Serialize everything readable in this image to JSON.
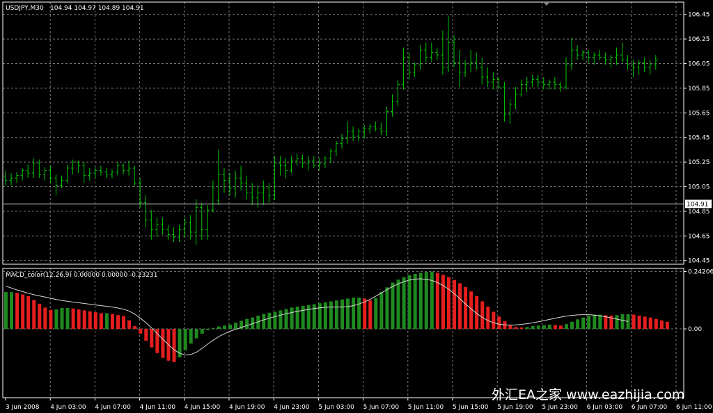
{
  "colors": {
    "background": "#000000",
    "frame": "#ffffff",
    "grid": "#7a7a7a",
    "bars": "#00c800",
    "macd_up": "#1f8a1f",
    "macd_down": "#e61e1e",
    "signal": "#d8d8d8",
    "current_price_bg": "#ffffff",
    "current_price_text": "#000000"
  },
  "header": {
    "symbol_label": "USDJPY,M30",
    "ohlc_label": "104.94 104.97 104.89 104.91"
  },
  "indicator": {
    "label": "MACD_color(12,26,9) 0.00000 0.00000 -0.23231"
  },
  "watermark": "外汇EA之家 www.eazhijia.com",
  "chart_data": [
    {
      "type": "ohlc",
      "title": "USDJPY,M30",
      "current_price": "104.91",
      "ylim": [
        104.42,
        106.55
      ],
      "y_ticks": [
        "106.45",
        "106.25",
        "106.05",
        "105.85",
        "105.65",
        "105.45",
        "105.25",
        "105.05",
        "104.85",
        "104.65",
        "104.45"
      ],
      "x_ticks": [
        "3 Jun 2008",
        "4 Jun 03:00",
        "4 Jun 07:00",
        "4 Jun 11:00",
        "4 Jun 15:00",
        "4 Jun 19:00",
        "4 Jun 23:00",
        "5 Jun 03:00",
        "5 Jun 07:00",
        "5 Jun 11:00",
        "5 Jun 15:00",
        "5 Jun 19:00",
        "5 Jun 23:00",
        "6 Jun 03:00",
        "6 Jun 07:00",
        "6 Jun 11:00"
      ],
      "grid": true,
      "bars": [
        [
          105.13,
          105.18,
          105.06,
          105.1
        ],
        [
          105.1,
          105.16,
          105.06,
          105.12
        ],
        [
          105.12,
          105.17,
          105.08,
          105.14
        ],
        [
          105.14,
          105.2,
          105.1,
          105.18
        ],
        [
          105.18,
          105.23,
          105.12,
          105.16
        ],
        [
          105.16,
          105.28,
          105.12,
          105.24
        ],
        [
          105.24,
          105.27,
          105.12,
          105.15
        ],
        [
          105.15,
          105.21,
          105.1,
          105.18
        ],
        [
          105.18,
          105.22,
          105.08,
          105.12
        ],
        [
          105.12,
          105.15,
          104.98,
          105.06
        ],
        [
          105.06,
          105.14,
          105.04,
          105.1
        ],
        [
          105.1,
          105.23,
          105.08,
          105.2
        ],
        [
          105.2,
          105.27,
          105.15,
          105.25
        ],
        [
          105.25,
          105.26,
          105.16,
          105.22
        ],
        [
          105.22,
          105.25,
          105.08,
          105.14
        ],
        [
          105.14,
          105.2,
          105.1,
          105.16
        ],
        [
          105.16,
          105.21,
          105.12,
          105.18
        ],
        [
          105.18,
          105.22,
          105.14,
          105.17
        ],
        [
          105.17,
          105.2,
          105.12,
          105.15
        ],
        [
          105.15,
          105.19,
          105.12,
          105.17
        ],
        [
          105.17,
          105.25,
          105.14,
          105.22
        ],
        [
          105.22,
          105.24,
          105.15,
          105.18
        ],
        [
          105.18,
          105.26,
          105.14,
          105.2
        ],
        [
          105.2,
          105.22,
          105.05,
          105.08
        ],
        [
          105.08,
          105.12,
          104.88,
          104.92
        ],
        [
          104.92,
          104.98,
          104.72,
          104.78
        ],
        [
          104.78,
          104.86,
          104.62,
          104.7
        ],
        [
          104.7,
          104.8,
          104.64,
          104.74
        ],
        [
          104.74,
          104.8,
          104.66,
          104.7
        ],
        [
          104.7,
          104.74,
          104.62,
          104.66
        ],
        [
          104.66,
          104.72,
          104.6,
          104.64
        ],
        [
          104.64,
          104.74,
          104.6,
          104.7
        ],
        [
          104.7,
          104.8,
          104.64,
          104.76
        ],
        [
          104.76,
          104.82,
          104.62,
          104.68
        ],
        [
          104.68,
          104.95,
          104.58,
          104.88
        ],
        [
          104.88,
          104.92,
          104.62,
          104.7
        ],
        [
          104.7,
          104.9,
          104.62,
          104.86
        ],
        [
          104.86,
          105.1,
          104.84,
          105.04
        ],
        [
          104.94,
          105.35,
          104.9,
          105.15
        ],
        [
          105.15,
          105.2,
          105.0,
          105.1
        ],
        [
          105.1,
          105.16,
          104.98,
          105.04
        ],
        [
          105.04,
          105.18,
          104.96,
          105.12
        ],
        [
          105.12,
          105.22,
          105.02,
          105.08
        ],
        [
          105.08,
          105.14,
          104.94,
          105.0
        ],
        [
          105.0,
          105.08,
          104.9,
          104.96
        ],
        [
          104.96,
          105.06,
          104.88,
          105.0
        ],
        [
          105.0,
          105.1,
          104.9,
          105.04
        ],
        [
          105.04,
          105.08,
          104.92,
          104.98
        ],
        [
          104.98,
          105.3,
          104.94,
          105.24
        ],
        [
          105.24,
          105.3,
          105.14,
          105.22
        ],
        [
          105.22,
          105.28,
          105.12,
          105.18
        ],
        [
          105.18,
          105.3,
          105.16,
          105.26
        ],
        [
          105.26,
          105.32,
          105.22,
          105.28
        ],
        [
          105.28,
          105.31,
          105.2,
          105.24
        ],
        [
          105.24,
          105.3,
          105.18,
          105.26
        ],
        [
          105.26,
          105.3,
          105.2,
          105.22
        ],
        [
          105.22,
          105.28,
          105.18,
          105.24
        ],
        [
          105.24,
          105.3,
          105.2,
          105.28
        ],
        [
          105.28,
          105.36,
          105.24,
          105.34
        ],
        [
          105.34,
          105.42,
          105.3,
          105.4
        ],
        [
          105.4,
          105.48,
          105.36,
          105.44
        ],
        [
          105.44,
          105.58,
          105.4,
          105.5
        ],
        [
          105.5,
          105.54,
          105.42,
          105.46
        ],
        [
          105.46,
          105.52,
          105.42,
          105.5
        ],
        [
          105.5,
          105.55,
          105.44,
          105.52
        ],
        [
          105.52,
          105.56,
          105.48,
          105.54
        ],
        [
          105.54,
          105.58,
          105.5,
          105.52
        ],
        [
          105.52,
          105.57,
          105.47,
          105.5
        ],
        [
          105.5,
          105.7,
          105.46,
          105.66
        ],
        [
          105.66,
          105.8,
          105.62,
          105.74
        ],
        [
          105.74,
          105.92,
          105.7,
          105.88
        ],
        [
          105.88,
          106.18,
          105.84,
          106.1
        ],
        [
          106.1,
          106.14,
          105.92,
          105.98
        ],
        [
          105.98,
          106.06,
          105.94,
          106.04
        ],
        [
          106.04,
          106.2,
          106.0,
          106.16
        ],
        [
          106.16,
          106.22,
          106.06,
          106.1
        ],
        [
          106.1,
          106.22,
          106.06,
          106.14
        ],
        [
          106.14,
          106.18,
          106.08,
          106.12
        ],
        [
          106.12,
          106.32,
          105.96,
          106.02
        ],
        [
          106.02,
          106.44,
          105.98,
          106.22
        ],
        [
          106.22,
          106.28,
          106.02,
          106.06
        ],
        [
          106.06,
          106.16,
          105.86,
          105.98
        ],
        [
          105.98,
          106.08,
          105.94,
          106.04
        ],
        [
          106.04,
          106.16,
          105.98,
          106.06
        ],
        [
          106.06,
          106.14,
          106.0,
          106.02
        ],
        [
          106.02,
          106.1,
          105.88,
          105.94
        ],
        [
          105.94,
          106.02,
          105.86,
          105.9
        ],
        [
          105.9,
          105.98,
          105.84,
          105.92
        ],
        [
          105.92,
          105.94,
          105.84,
          105.86
        ],
        [
          105.86,
          105.9,
          105.58,
          105.64
        ],
        [
          105.64,
          105.76,
          105.56,
          105.72
        ],
        [
          105.72,
          105.86,
          105.68,
          105.8
        ],
        [
          105.8,
          105.92,
          105.78,
          105.88
        ],
        [
          105.88,
          105.94,
          105.82,
          105.9
        ],
        [
          105.9,
          105.96,
          105.86,
          105.92
        ],
        [
          105.92,
          105.96,
          105.86,
          105.9
        ],
        [
          105.9,
          105.94,
          105.84,
          105.88
        ],
        [
          105.88,
          105.92,
          105.84,
          105.9
        ],
        [
          105.9,
          105.94,
          105.84,
          105.88
        ],
        [
          105.88,
          105.9,
          105.82,
          105.86
        ],
        [
          105.86,
          106.1,
          105.84,
          106.04
        ],
        [
          106.04,
          106.26,
          106.0,
          106.16
        ],
        [
          106.16,
          106.2,
          106.08,
          106.12
        ],
        [
          106.12,
          106.16,
          106.08,
          106.14
        ],
        [
          106.14,
          106.16,
          106.06,
          106.1
        ],
        [
          106.1,
          106.14,
          106.04,
          106.12
        ],
        [
          106.12,
          106.16,
          106.08,
          106.1
        ],
        [
          106.1,
          106.14,
          106.04,
          106.08
        ],
        [
          106.08,
          106.12,
          106.02,
          106.1
        ],
        [
          106.1,
          106.18,
          106.04,
          106.12
        ],
        [
          106.12,
          106.22,
          106.06,
          106.08
        ],
        [
          106.08,
          106.12,
          106.0,
          106.04
        ],
        [
          106.04,
          106.08,
          105.94,
          106.02
        ],
        [
          106.02,
          106.08,
          105.96,
          106.06
        ],
        [
          106.06,
          106.1,
          105.98,
          106.02
        ],
        [
          106.02,
          106.08,
          105.96,
          106.04
        ],
        [
          106.04,
          106.12,
          106.0,
          106.08
        ]
      ]
    },
    {
      "type": "bar",
      "title": "MACD_color(12,26,9)",
      "ylim": [
        -0.29,
        0.255
      ],
      "y_ticks": [
        "0.24206",
        "0.00"
      ],
      "grid": true,
      "histogram": [
        0.155,
        0.155,
        0.152,
        0.145,
        0.138,
        0.122,
        0.106,
        0.09,
        0.08,
        0.082,
        0.088,
        0.088,
        0.086,
        0.082,
        0.078,
        0.074,
        0.07,
        0.066,
        0.066,
        0.063,
        0.058,
        0.054,
        0.036,
        0.012,
        -0.02,
        -0.05,
        -0.078,
        -0.102,
        -0.122,
        -0.134,
        -0.14,
        -0.12,
        -0.09,
        -0.062,
        -0.04,
        -0.02,
        -0.005,
        0.004,
        0.01,
        0.014,
        0.018,
        0.026,
        0.034,
        0.042,
        0.048,
        0.056,
        0.063,
        0.068,
        0.072,
        0.078,
        0.084,
        0.09,
        0.094,
        0.097,
        0.1,
        0.104,
        0.108,
        0.112,
        0.116,
        0.12,
        0.124,
        0.128,
        0.132,
        0.132,
        0.128,
        0.12,
        0.13,
        0.155,
        0.175,
        0.195,
        0.208,
        0.218,
        0.226,
        0.232,
        0.236,
        0.24,
        0.242,
        0.236,
        0.228,
        0.218,
        0.206,
        0.192,
        0.176,
        0.158,
        0.138,
        0.116,
        0.094,
        0.072,
        0.052,
        0.032,
        0.016,
        0.008,
        0.006,
        0.008,
        0.012,
        0.014,
        0.016,
        0.018,
        0.016,
        0.014,
        0.02,
        0.03,
        0.04,
        0.048,
        0.056,
        0.06,
        0.06,
        0.058,
        0.056,
        0.058,
        0.062,
        0.062,
        0.06,
        0.056,
        0.052,
        0.048,
        0.042,
        0.036,
        0.03
      ],
      "signal_line": [
        0.18,
        0.172,
        0.164,
        0.157,
        0.15,
        0.144,
        0.139,
        0.134,
        0.129,
        0.124,
        0.12,
        0.116,
        0.113,
        0.11,
        0.107,
        0.104,
        0.101,
        0.098,
        0.095,
        0.092,
        0.088,
        0.083,
        0.075,
        0.062,
        0.045,
        0.026,
        0.004,
        -0.02,
        -0.044,
        -0.067,
        -0.088,
        -0.103,
        -0.11,
        -0.108,
        -0.098,
        -0.082,
        -0.064,
        -0.047,
        -0.032,
        -0.02,
        -0.01,
        -0.002,
        0.006,
        0.014,
        0.022,
        0.03,
        0.038,
        0.045,
        0.052,
        0.058,
        0.064,
        0.069,
        0.074,
        0.078,
        0.082,
        0.086,
        0.089,
        0.091,
        0.092,
        0.092,
        0.092,
        0.094,
        0.098,
        0.105,
        0.114,
        0.125,
        0.138,
        0.152,
        0.166,
        0.179,
        0.19,
        0.199,
        0.206,
        0.21,
        0.211,
        0.209,
        0.204,
        0.195,
        0.183,
        0.167,
        0.148,
        0.127,
        0.105,
        0.084,
        0.065,
        0.048,
        0.035,
        0.026,
        0.02,
        0.017,
        0.016,
        0.017,
        0.019,
        0.022,
        0.026,
        0.03,
        0.035,
        0.04,
        0.045,
        0.05,
        0.054,
        0.057,
        0.059,
        0.06,
        0.06,
        0.058,
        0.055,
        0.051,
        0.046,
        0.041,
        0.036,
        0.031
      ]
    }
  ]
}
